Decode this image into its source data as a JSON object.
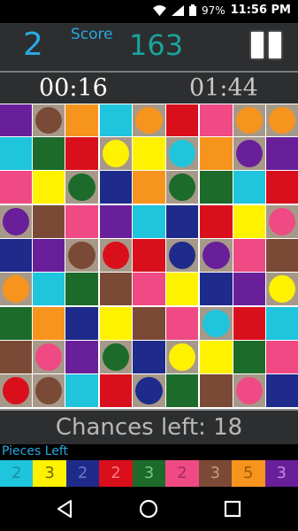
{
  "status_bar": {
    "battery": "97%",
    "time": "11:56 PM"
  },
  "header": {
    "level": "2",
    "score_label": "Score",
    "score": "163"
  },
  "timers": {
    "elapsed": "00:16",
    "remaining": "01:44"
  },
  "colors": {
    "purple": "#6a1f9a",
    "brown": "#7b4a36",
    "orange": "#f7941d",
    "cyan": "#1fc4dd",
    "red": "#d9101c",
    "yellow": "#fff200",
    "pink": "#ef4a84",
    "green": "#1c6b2b",
    "navy": "#1e2b8a",
    "cell_bg": "#a79989"
  },
  "board": [
    [
      {
        "c": "purple",
        "s": "square"
      },
      {
        "c": "brown",
        "s": "circle"
      },
      {
        "c": "orange",
        "s": "square"
      },
      {
        "c": "cyan",
        "s": "square"
      },
      {
        "c": "orange",
        "s": "circle"
      },
      {
        "c": "red",
        "s": "square"
      },
      {
        "c": "pink",
        "s": "square"
      },
      {
        "c": "orange",
        "s": "circle"
      },
      {
        "c": "orange",
        "s": "circle"
      }
    ],
    [
      {
        "c": "cyan",
        "s": "square"
      },
      {
        "c": "green",
        "s": "square"
      },
      {
        "c": "red",
        "s": "square"
      },
      {
        "c": "yellow",
        "s": "circle"
      },
      {
        "c": "yellow",
        "s": "square"
      },
      {
        "c": "cyan",
        "s": "circle"
      },
      {
        "c": "orange",
        "s": "square"
      },
      {
        "c": "purple",
        "s": "circle"
      },
      {
        "c": "purple",
        "s": "square"
      }
    ],
    [
      {
        "c": "pink",
        "s": "square"
      },
      {
        "c": "yellow",
        "s": "square"
      },
      {
        "c": "green",
        "s": "circle"
      },
      {
        "c": "navy",
        "s": "square"
      },
      {
        "c": "orange",
        "s": "square"
      },
      {
        "c": "green",
        "s": "circle"
      },
      {
        "c": "green",
        "s": "square"
      },
      {
        "c": "cyan",
        "s": "square"
      },
      {
        "c": "red",
        "s": "square"
      }
    ],
    [
      {
        "c": "purple",
        "s": "circle"
      },
      {
        "c": "brown",
        "s": "square"
      },
      {
        "c": "pink",
        "s": "square"
      },
      {
        "c": "purple",
        "s": "square"
      },
      {
        "c": "cyan",
        "s": "square"
      },
      {
        "c": "navy",
        "s": "square"
      },
      {
        "c": "red",
        "s": "square"
      },
      {
        "c": "yellow",
        "s": "square"
      },
      {
        "c": "pink",
        "s": "circle"
      }
    ],
    [
      {
        "c": "navy",
        "s": "square"
      },
      {
        "c": "purple",
        "s": "square"
      },
      {
        "c": "brown",
        "s": "circle"
      },
      {
        "c": "red",
        "s": "circle"
      },
      {
        "c": "red",
        "s": "square"
      },
      {
        "c": "navy",
        "s": "circle"
      },
      {
        "c": "purple",
        "s": "circle"
      },
      {
        "c": "pink",
        "s": "square"
      },
      {
        "c": "brown",
        "s": "square"
      }
    ],
    [
      {
        "c": "orange",
        "s": "circle"
      },
      {
        "c": "cyan",
        "s": "square"
      },
      {
        "c": "green",
        "s": "square"
      },
      {
        "c": "brown",
        "s": "square"
      },
      {
        "c": "pink",
        "s": "square"
      },
      {
        "c": "yellow",
        "s": "square"
      },
      {
        "c": "navy",
        "s": "square"
      },
      {
        "c": "purple",
        "s": "square"
      },
      {
        "c": "yellow",
        "s": "circle"
      }
    ],
    [
      {
        "c": "green",
        "s": "square"
      },
      {
        "c": "orange",
        "s": "square"
      },
      {
        "c": "navy",
        "s": "square"
      },
      {
        "c": "yellow",
        "s": "square"
      },
      {
        "c": "brown",
        "s": "square"
      },
      {
        "c": "pink",
        "s": "square"
      },
      {
        "c": "cyan",
        "s": "circle"
      },
      {
        "c": "red",
        "s": "square"
      },
      {
        "c": "cyan",
        "s": "square"
      }
    ],
    [
      {
        "c": "brown",
        "s": "square"
      },
      {
        "c": "pink",
        "s": "circle"
      },
      {
        "c": "purple",
        "s": "square"
      },
      {
        "c": "green",
        "s": "circle"
      },
      {
        "c": "navy",
        "s": "square"
      },
      {
        "c": "yellow",
        "s": "circle"
      },
      {
        "c": "yellow",
        "s": "square"
      },
      {
        "c": "green",
        "s": "square"
      },
      {
        "c": "pink",
        "s": "square"
      }
    ],
    [
      {
        "c": "red",
        "s": "circle"
      },
      {
        "c": "brown",
        "s": "circle"
      },
      {
        "c": "cyan",
        "s": "square"
      },
      {
        "c": "red",
        "s": "square"
      },
      {
        "c": "navy",
        "s": "circle"
      },
      {
        "c": "green",
        "s": "square"
      },
      {
        "c": "brown",
        "s": "square"
      },
      {
        "c": "pink",
        "s": "circle"
      },
      {
        "c": "navy",
        "s": "square"
      }
    ]
  ],
  "chances": {
    "text": "Chances left: 18"
  },
  "pieces_left": {
    "label": "Pieces Left",
    "items": [
      {
        "color": "cyan",
        "count": "2",
        "text": "#1a8fa0"
      },
      {
        "color": "yellow",
        "count": "3",
        "text": "#6f6a00"
      },
      {
        "color": "navy",
        "count": "2",
        "text": "#6a78c8"
      },
      {
        "color": "red",
        "count": "2",
        "text": "#ff7a80"
      },
      {
        "color": "green",
        "count": "3",
        "text": "#7fc489"
      },
      {
        "color": "pink",
        "count": "2",
        "text": "#a82a5c"
      },
      {
        "color": "brown",
        "count": "3",
        "text": "#c79a86"
      },
      {
        "color": "orange",
        "count": "5",
        "text": "#9a5a00"
      },
      {
        "color": "purple",
        "count": "3",
        "text": "#c08ae0"
      }
    ]
  }
}
